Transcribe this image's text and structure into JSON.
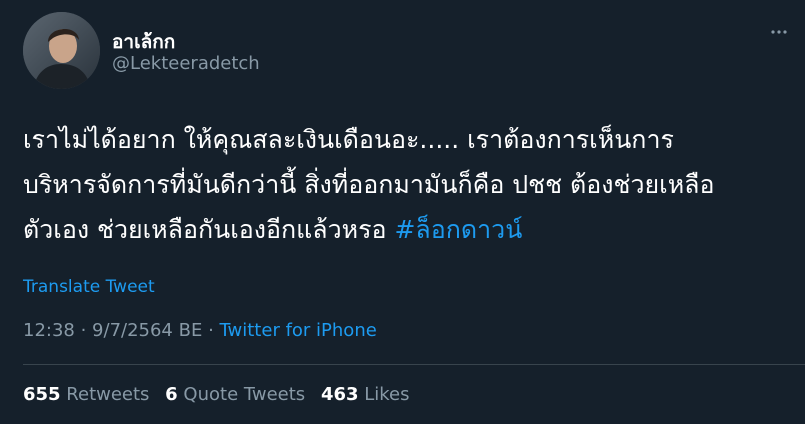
{
  "user": {
    "display_name": "อาเล้กก",
    "handle": "@Lekteeradetch"
  },
  "tweet": {
    "line1": "เราไม่ได้อยาก ให้คุณสละเงินเดือนอะ..... เราต้องการเห็นการ",
    "line2": "บริหารจัดการที่มันดีกว่านี้ สิ่งที่ออกมามันก็คือ ปชช ต้องช่วยเหลือ",
    "line3": "ตัวเอง ช่วยเหลือกันเองอีกแล้วหรอ ",
    "hashtag": "#ล็อกดาวน์",
    "translate": "Translate Tweet"
  },
  "meta": {
    "time": "12:38",
    "sep1": " · ",
    "date": "9/7/2564 BE",
    "sep2": " · ",
    "source": "Twitter for iPhone"
  },
  "stats": {
    "retweets_count": "655",
    "retweets_label": " Retweets",
    "quotes_count": "6",
    "quotes_label": " Quote Tweets",
    "likes_count": "463",
    "likes_label": " Likes"
  },
  "icons": {
    "more": "more-horizontal-icon"
  },
  "colors": {
    "background": "#15202b",
    "accent": "#1d9bf0",
    "secondary_text": "#8899a6"
  }
}
